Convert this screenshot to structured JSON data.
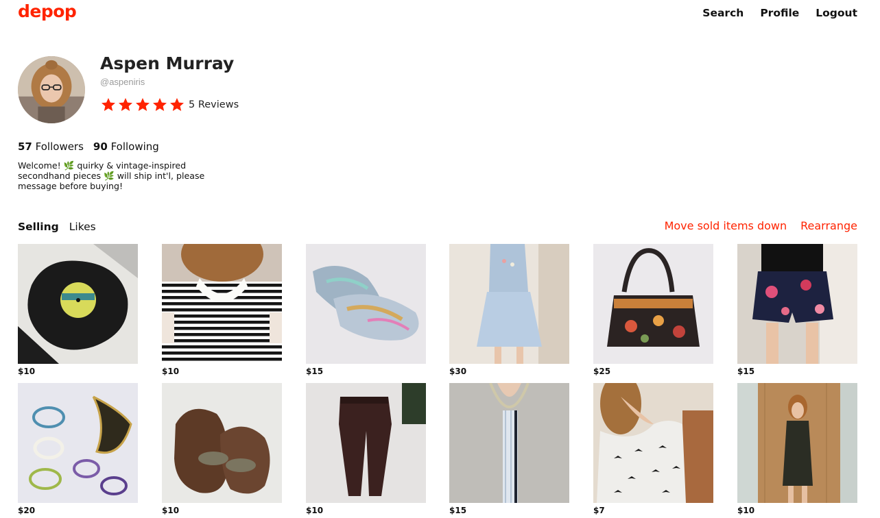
{
  "brand": {
    "logo": "depop",
    "accent": "#ff2300"
  },
  "nav": {
    "search": "Search",
    "profile": "Profile",
    "logout": "Logout"
  },
  "profile": {
    "name": "Aspen Murray",
    "handle": "@aspeniris",
    "rating_stars": 5,
    "reviews": "5 Reviews",
    "followers_count": "57",
    "followers_label": "Followers",
    "following_count": "90",
    "following_label": "Following",
    "bio": "Welcome! 🌿 quirky & vintage-inspired secondhand pieces 🌿 will ship int'l, please message before buying!"
  },
  "tabs": {
    "selling": "Selling",
    "likes": "Likes"
  },
  "actions": {
    "move_sold": "Move sold items down",
    "rearrange": "Rearrange"
  },
  "items": [
    {
      "price": "$10",
      "image": "vinyl-record-bowl"
    },
    {
      "price": "$10",
      "image": "striped-collar-top"
    },
    {
      "price": "$15",
      "image": "holographic-oxford-shoes"
    },
    {
      "price": "$30",
      "image": "light-blue-dress"
    },
    {
      "price": "$25",
      "image": "floral-black-handbag"
    },
    {
      "price": "$15",
      "image": "floral-navy-shorts"
    },
    {
      "price": "$20",
      "image": "beaded-necklaces"
    },
    {
      "price": "$10",
      "image": "brown-leather-flats"
    },
    {
      "price": "$10",
      "image": "burgundy-leggings"
    },
    {
      "price": "$15",
      "image": "grey-cardigan"
    },
    {
      "price": "$7",
      "image": "bird-print-cardigan"
    },
    {
      "price": "$10",
      "image": "black-lace-dress"
    }
  ]
}
